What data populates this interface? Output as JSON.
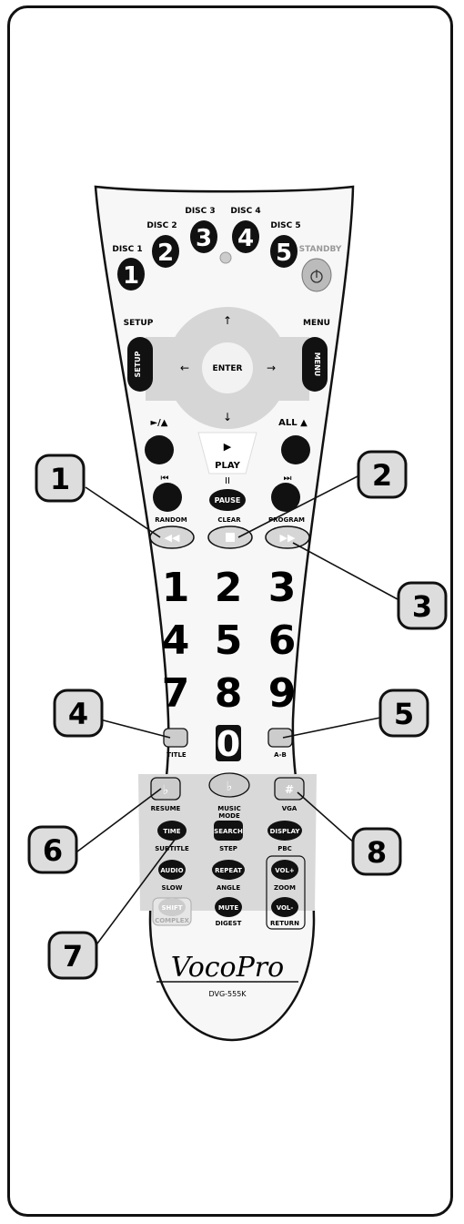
{
  "discs": [
    {
      "label": "DISC 1",
      "num": "1"
    },
    {
      "label": "DISC 2",
      "num": "2"
    },
    {
      "label": "DISC 3",
      "num": "3"
    },
    {
      "label": "DISC 4",
      "num": "4"
    },
    {
      "label": "DISC 5",
      "num": "5"
    }
  ],
  "standby_label": "STANDBY",
  "setup_label": "SETUP",
  "menu_label": "MENU",
  "enter_label": "ENTER",
  "play_label": "PLAY",
  "eject_label": "►/▲",
  "all_eject_label": "ALL ▲",
  "pause_label": "PAUSE",
  "random_label": "RANDOM",
  "clear_label": "CLEAR",
  "program_label": "PROGRAM",
  "digits": [
    "1",
    "2",
    "3",
    "4",
    "5",
    "6",
    "7",
    "8",
    "9",
    "0"
  ],
  "title_label": "TITLE",
  "ab_label": "A-B",
  "resume_label": "RESUME",
  "music_mode_label": [
    "MUSIC",
    "MODE"
  ],
  "vga_label": "VGA",
  "flat_sym": "♭",
  "sharp_sym": "#",
  "function_buttons": [
    {
      "btn": "TIME",
      "sub": "SUBTITLE"
    },
    {
      "btn": "SEARCH",
      "sub": "STEP"
    },
    {
      "btn": "DISPLAY",
      "sub": "PBC"
    },
    {
      "btn": "AUDIO",
      "sub": "SLOW"
    },
    {
      "btn": "REPEAT",
      "sub": "ANGLE"
    },
    {
      "btn": "VOL+",
      "sub": "ZOOM"
    },
    {
      "btn": "SHIFT",
      "sub": "COMPLEX"
    },
    {
      "btn": "MUTE",
      "sub": "DIGEST"
    },
    {
      "btn": "VOL-",
      "sub": "RETURN"
    }
  ],
  "brand": "VocoPro",
  "model": "DVG-555K",
  "callouts": [
    "1",
    "2",
    "3",
    "4",
    "5",
    "6",
    "7",
    "8"
  ],
  "colors": {
    "body": "#f5f5f5",
    "outline": "#111111",
    "pad": "#d6d6d6",
    "button": "#111111",
    "panel": "#d9d9d9"
  }
}
